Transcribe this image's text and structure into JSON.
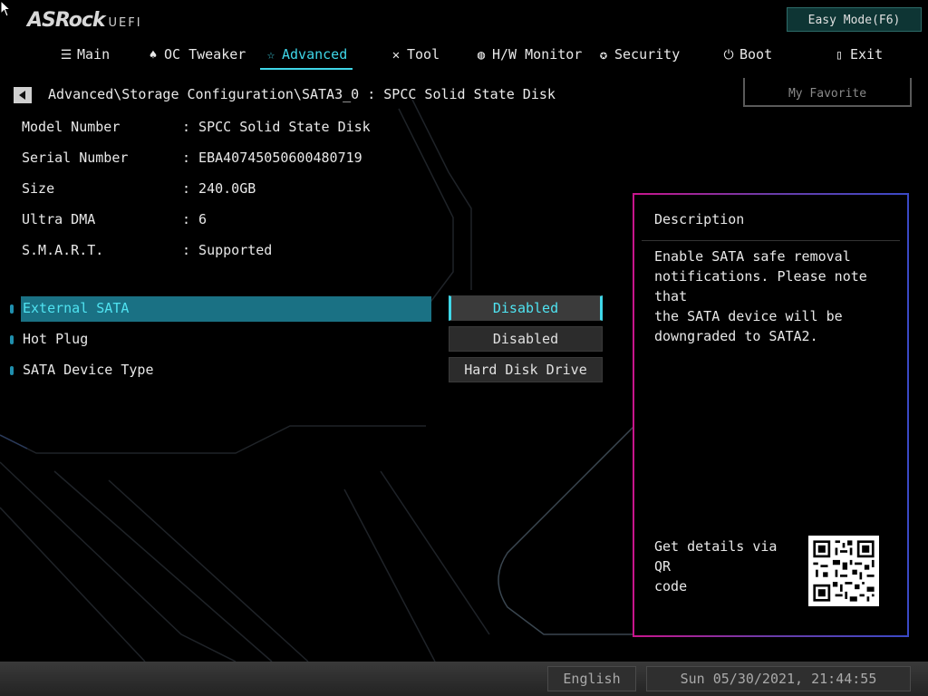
{
  "brand": {
    "logo": "ASRock",
    "sub": "UEFI"
  },
  "easy_mode_label": "Easy Mode(F6)",
  "menu": [
    {
      "label": "Main",
      "icon": "list-icon"
    },
    {
      "label": "OC Tweaker",
      "icon": "rocket-icon"
    },
    {
      "label": "Advanced",
      "icon": "star-icon",
      "active": true
    },
    {
      "label": "Tool",
      "icon": "tools-icon"
    },
    {
      "label": "H/W Monitor",
      "icon": "monitor-icon"
    },
    {
      "label": "Security",
      "icon": "shield-icon"
    },
    {
      "label": "Boot",
      "icon": "power-icon"
    },
    {
      "label": "Exit",
      "icon": "door-icon"
    }
  ],
  "breadcrumb": "Advanced\\Storage Configuration\\SATA3_0 : SPCC Solid State Disk",
  "favorite_label": "My Favorite",
  "info": [
    {
      "key": "Model Number",
      "value": ": SPCC Solid State Disk"
    },
    {
      "key": "Serial Number",
      "value": ": EBA40745050600480719"
    },
    {
      "key": "Size",
      "value": ": 240.0GB"
    },
    {
      "key": "Ultra DMA",
      "value": ": 6"
    },
    {
      "key": "S.M.A.R.T.",
      "value": ": Supported"
    }
  ],
  "settings": [
    {
      "label": "External SATA",
      "value": "Disabled",
      "selected": true
    },
    {
      "label": "Hot Plug",
      "value": "Disabled"
    },
    {
      "label": "SATA Device Type",
      "value": "Hard Disk Drive"
    }
  ],
  "description": {
    "title": "Description",
    "text": "Enable SATA safe removal\nnotifications. Please note that\nthe SATA device will be\ndowngraded to SATA2.",
    "qr_label": "Get details via QR\ncode"
  },
  "status": {
    "language": "English",
    "datetime": "Sun 05/30/2021, 21:44:55"
  },
  "colors": {
    "accent": "#3fd7e8",
    "selected_row": "#1a7184",
    "panel_border_left": "#c8158c",
    "panel_border_right": "#3a49c6"
  }
}
